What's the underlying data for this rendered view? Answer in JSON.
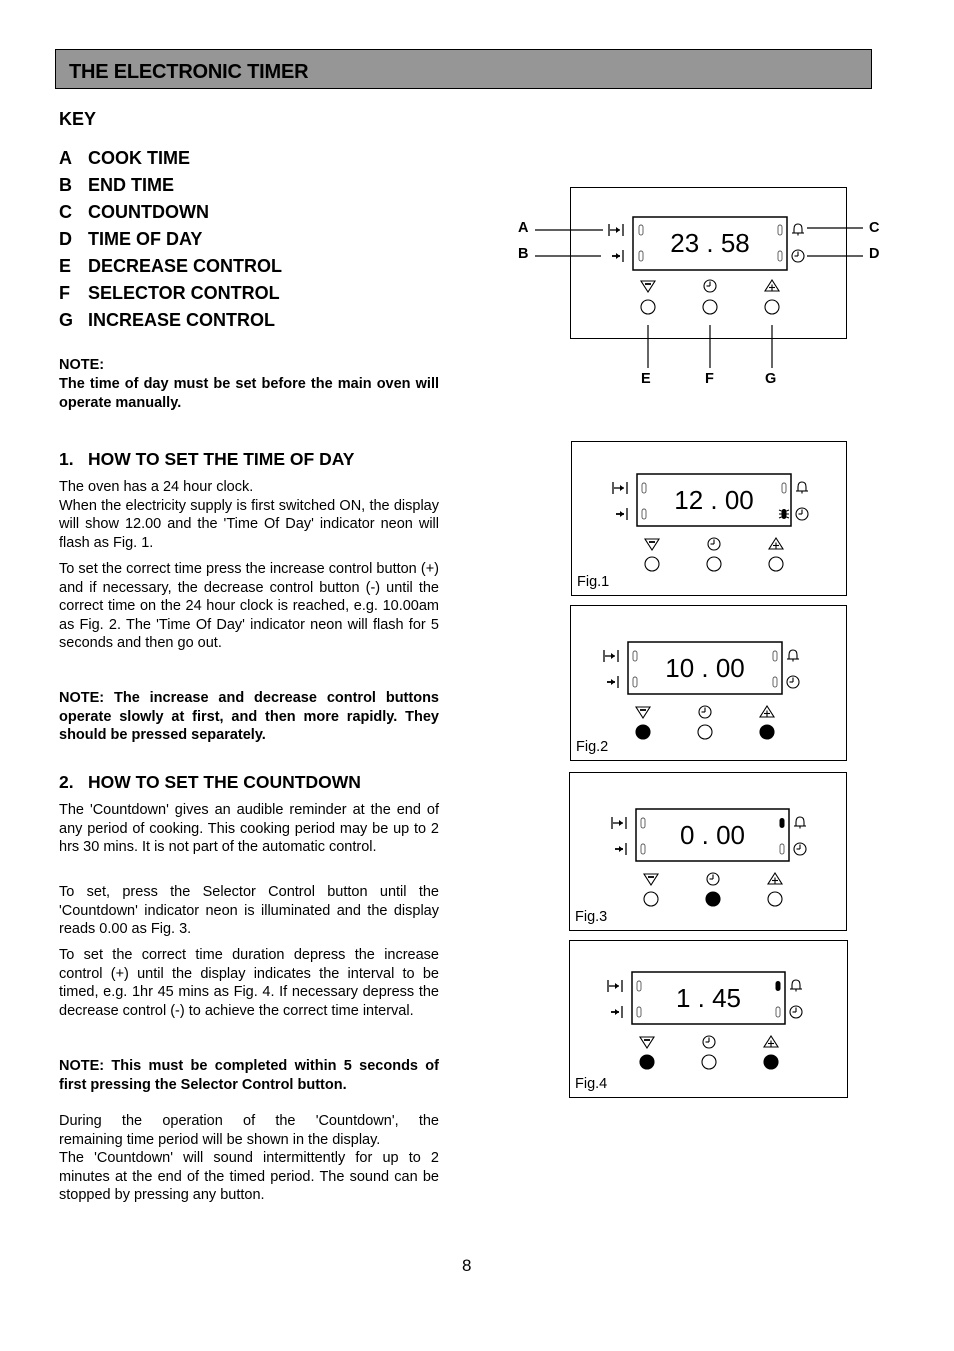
{
  "header": {
    "title": "THE ELECTRONIC TIMER"
  },
  "key": {
    "heading": "KEY",
    "items": [
      {
        "letter": "A",
        "label": "COOK TIME"
      },
      {
        "letter": "B",
        "label": "END TIME"
      },
      {
        "letter": "C",
        "label": "COUNTDOWN"
      },
      {
        "letter": "D",
        "label": "TIME OF DAY"
      },
      {
        "letter": "E",
        "label": "DECREASE CONTROL"
      },
      {
        "letter": "F",
        "label": "SELECTOR CONTROL"
      },
      {
        "letter": "G",
        "label": "INCREASE CONTROL"
      }
    ]
  },
  "note1": {
    "title": "NOTE:",
    "text": "The time of day must be set before the main oven will operate manually."
  },
  "section1": {
    "number": "1.",
    "heading": "HOW TO SET THE TIME OF DAY",
    "p1_line1": "The oven has a 24 hour clock.",
    "p1_rest": "When the electricity supply is first switched ON, the display will show 12.00 and the 'Time Of Day' indicator neon will flash as Fig. 1.",
    "p2": "To set the correct time press the increase control button (+) and if necessary, the decrease control button (-) until the correct time on the 24 hour clock is reached, e.g. 10.00am as Fig. 2.  The 'Time Of Day' indicator neon will flash for 5 seconds and then go out.",
    "note": "NOTE:  The increase and decrease control buttons operate slowly at first, and then more rapidly.  They should be pressed separately."
  },
  "section2": {
    "number": "2.",
    "heading": "HOW TO SET THE COUNTDOWN",
    "p1": "The 'Countdown' gives an audible reminder at the end of any period of cooking. This cooking period may be  up to 2 hrs 30 mins. It is not part of the automatic control.",
    "p2": "To set, press the Selector Control button until the 'Countdown' indicator neon is illuminated and the display reads 0.00 as Fig. 3.",
    "p3": "To set the correct time duration depress the increase control (+) until the display indicates the interval to be timed, e.g. 1hr 45 mins as Fig. 4. If necessary depress the decrease control (-) to achieve the correct time interval.",
    "note": "NOTE:  This must be completed within 5 seconds of first pressing the Selector Control button.",
    "p4_line1": "During the operation of the 'Countdown', the",
    "p4_line2": "remaining time period will be shown in the display.",
    "p4_rest": "The 'Countdown' will sound intermittently for up to 2 minutes at the end of the timed period. The sound can be stopped by pressing any button."
  },
  "key_diagram": {
    "display": "23 . 58",
    "callouts": {
      "A": "A",
      "B": "B",
      "C": "C",
      "D": "D",
      "E": "E",
      "F": "F",
      "G": "G"
    },
    "icons": {
      "cook_time": "cook-time-icon",
      "end_time": "end-time-icon",
      "countdown": "bell-icon",
      "time_of_day": "clock-icon",
      "decrease": "minus-triangle-icon",
      "selector": "clock-icon",
      "increase": "plus-triangle-icon"
    }
  },
  "figures": [
    {
      "label": "Fig.1",
      "display": "12 . 00",
      "countdown_neon": "off",
      "timeofday_neon": "flashing",
      "buttons": {
        "decrease": "released",
        "selector": "released",
        "increase": "released"
      }
    },
    {
      "label": "Fig.2",
      "display": "10 . 00",
      "countdown_neon": "off",
      "timeofday_neon": "off",
      "buttons": {
        "decrease": "pressed",
        "selector": "released",
        "increase": "pressed"
      }
    },
    {
      "label": "Fig.3",
      "display": "0 . 00",
      "countdown_neon": "on",
      "timeofday_neon": "off",
      "buttons": {
        "decrease": "released",
        "selector": "pressed",
        "increase": "released"
      }
    },
    {
      "label": "Fig.4",
      "display": "1 . 45",
      "countdown_neon": "on",
      "timeofday_neon": "off",
      "buttons": {
        "decrease": "pressed",
        "selector": "released",
        "increase": "pressed"
      }
    }
  ],
  "page": {
    "number": "8"
  }
}
